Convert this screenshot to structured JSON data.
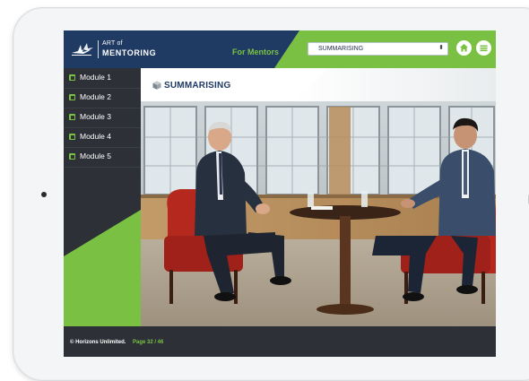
{
  "header": {
    "logo_line1": "ART of",
    "logo_line2": "MENTORING",
    "audience_label": "For Mentors",
    "module_select": {
      "selected": "SUMMARISING"
    },
    "home_icon": "home-icon",
    "menu_icon": "menu-icon"
  },
  "sidebar": {
    "items": [
      {
        "label": "Module 1"
      },
      {
        "label": "Module 2"
      },
      {
        "label": "Module 3"
      },
      {
        "label": "Module 4"
      },
      {
        "label": "Module 5"
      }
    ]
  },
  "main": {
    "title": "SUMMARISING",
    "image_subject": "two men in suits seated at a round table in an office interview"
  },
  "footer": {
    "copyright": "© Horizons Unlimited.",
    "page": "Page 32 / 46"
  },
  "colors": {
    "navy": "#1f3a63",
    "green": "#7ac143",
    "dark": "#2d3137"
  }
}
